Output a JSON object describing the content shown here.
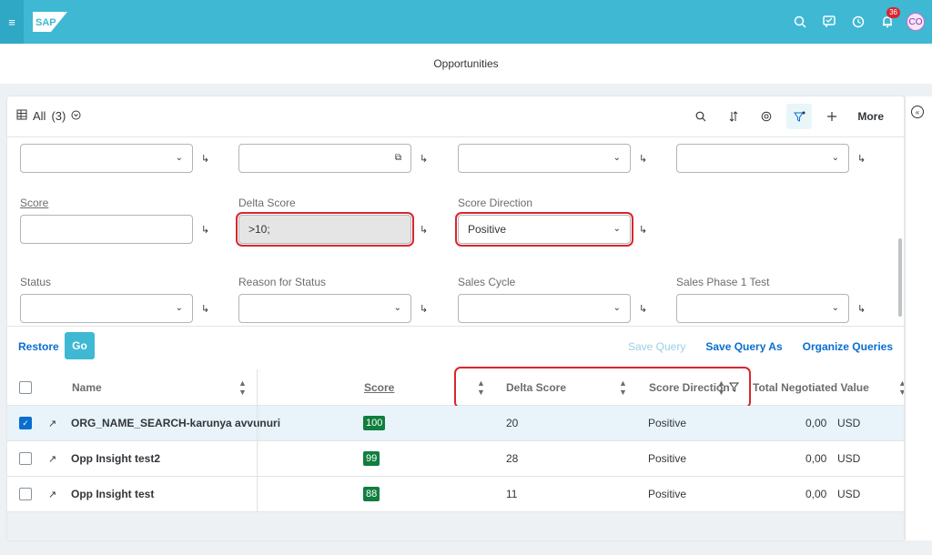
{
  "shell": {
    "logo_text": "SAP",
    "notification_count": "36",
    "avatar_initials": "CO"
  },
  "page": {
    "title": "Opportunities"
  },
  "toolbar": {
    "view_name": "All",
    "view_count": "(3)",
    "more_label": "More"
  },
  "filters": {
    "score_label": "Score",
    "delta_score_label": "Delta Score",
    "delta_score_value": ">10;",
    "score_direction_label": "Score Direction",
    "score_direction_value": "Positive",
    "status_label": "Status",
    "reason_for_status_label": "Reason for Status",
    "sales_cycle_label": "Sales Cycle",
    "sales_phase_label": "Sales Phase 1 Test"
  },
  "footer": {
    "restore_label": "Restore",
    "go_label": "Go",
    "save_query_label": "Save Query",
    "save_query_as_label": "Save Query As",
    "organize_queries_label": "Organize Queries"
  },
  "table": {
    "columns": {
      "name": "Name",
      "score": "Score",
      "delta_score": "Delta Score",
      "score_direction": "Score Direction",
      "total_negotiated_value": "Total Negotiated Value"
    },
    "rows": [
      {
        "name": "ORG_NAME_SEARCH-karunya avvunuri",
        "score": "100",
        "delta": "20",
        "direction": "Positive",
        "value": "0,00",
        "currency": "USD",
        "selected": true
      },
      {
        "name": "Opp Insight test2",
        "score": "99",
        "delta": "28",
        "direction": "Positive",
        "value": "0,00",
        "currency": "USD",
        "selected": false
      },
      {
        "name": "Opp Insight test",
        "score": "88",
        "delta": "11",
        "direction": "Positive",
        "value": "0,00",
        "currency": "USD",
        "selected": false
      }
    ]
  },
  "colors": {
    "shell_bg": "#3fb8d4",
    "accent": "#0a6ed1",
    "score_badge": "#107e3e",
    "highlight": "#d8262e"
  }
}
